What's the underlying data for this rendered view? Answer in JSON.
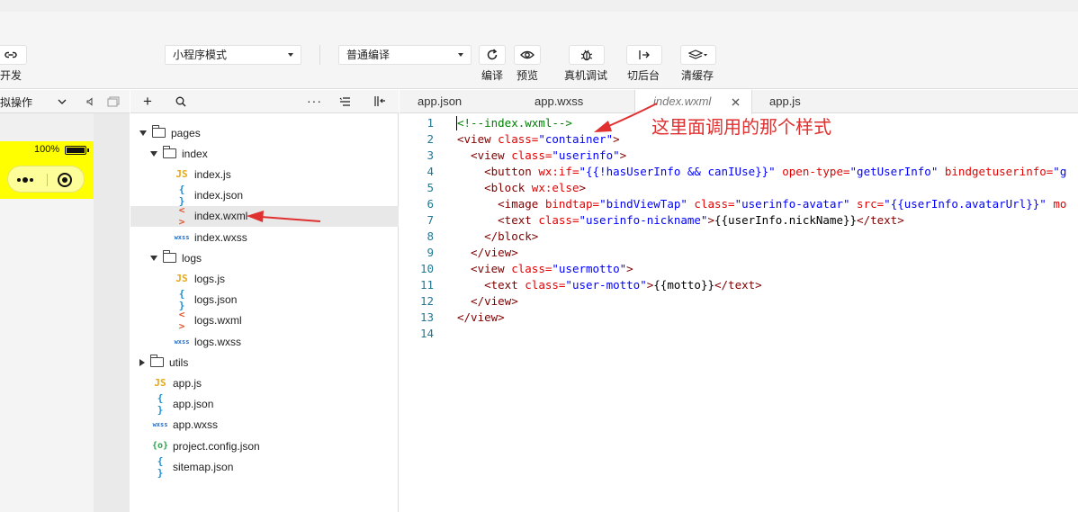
{
  "toolbar": {
    "cloud_label": "云开发",
    "mode_select": "小程序模式",
    "compile_select": "普通编译",
    "compile_label": "编译",
    "preview_label": "预览",
    "device_debug_label": "真机调试",
    "background_label": "切后台",
    "clear_cache_label": "清缓存"
  },
  "simulator": {
    "op_label": "模拟操作",
    "battery_text": "100%"
  },
  "file_tree": {
    "items": [
      {
        "label": "pages",
        "type": "folder",
        "expanded": true,
        "depth": 0
      },
      {
        "label": "index",
        "type": "folder",
        "expanded": true,
        "depth": 1
      },
      {
        "label": "index.js",
        "type": "js",
        "depth": 2
      },
      {
        "label": "index.json",
        "type": "json",
        "depth": 2
      },
      {
        "label": "index.wxml",
        "type": "wxml",
        "depth": 2,
        "selected": true
      },
      {
        "label": "index.wxss",
        "type": "wxss",
        "depth": 2
      },
      {
        "label": "logs",
        "type": "folder",
        "expanded": true,
        "depth": 1
      },
      {
        "label": "logs.js",
        "type": "js",
        "depth": 2
      },
      {
        "label": "logs.json",
        "type": "json",
        "depth": 2
      },
      {
        "label": "logs.wxml",
        "type": "wxml",
        "depth": 2
      },
      {
        "label": "logs.wxss",
        "type": "wxss",
        "depth": 2
      },
      {
        "label": "utils",
        "type": "folder",
        "expanded": false,
        "depth": 0
      },
      {
        "label": "app.js",
        "type": "js",
        "depth": 0
      },
      {
        "label": "app.json",
        "type": "json",
        "depth": 0
      },
      {
        "label": "app.wxss",
        "type": "wxss",
        "depth": 0
      },
      {
        "label": "project.config.json",
        "type": "cfg",
        "depth": 0
      },
      {
        "label": "sitemap.json",
        "type": "json",
        "depth": 0
      }
    ]
  },
  "file_icons": {
    "js": "JS",
    "json": "{ }",
    "wxml": "< >",
    "wxss": "wxss",
    "cfg": "{o}"
  },
  "editor": {
    "tabs": [
      {
        "label": "app.json",
        "active": false
      },
      {
        "label": "app.wxss",
        "active": false
      },
      {
        "label": "index.wxml",
        "active": true
      },
      {
        "label": "app.js",
        "active": false
      }
    ],
    "lines": [
      [
        {
          "t": "com",
          "s": "<!--index.wxml-->"
        }
      ],
      [
        {
          "t": "tag",
          "s": "<view "
        },
        {
          "t": "attr",
          "s": "class="
        },
        {
          "t": "val",
          "s": "\"container\""
        },
        {
          "t": "tag",
          "s": ">"
        }
      ],
      [
        {
          "t": "tag",
          "s": "  <view "
        },
        {
          "t": "attr",
          "s": "class="
        },
        {
          "t": "val",
          "s": "\"userinfo\""
        },
        {
          "t": "tag",
          "s": ">"
        }
      ],
      [
        {
          "t": "tag",
          "s": "    <button "
        },
        {
          "t": "attr",
          "s": "wx:if="
        },
        {
          "t": "val",
          "s": "\"{{!hasUserInfo && canIUse}}\""
        },
        {
          "t": "attr",
          "s": " open-type="
        },
        {
          "t": "val",
          "s": "\"getUserInfo\""
        },
        {
          "t": "attr",
          "s": " bindgetuserinfo="
        },
        {
          "t": "val",
          "s": "\"g"
        }
      ],
      [
        {
          "t": "tag",
          "s": "    <block "
        },
        {
          "t": "attr",
          "s": "wx:else"
        },
        {
          "t": "tag",
          "s": ">"
        }
      ],
      [
        {
          "t": "tag",
          "s": "      <image "
        },
        {
          "t": "attr",
          "s": "bindtap="
        },
        {
          "t": "val",
          "s": "\"bindViewTap\""
        },
        {
          "t": "attr",
          "s": " class="
        },
        {
          "t": "val",
          "s": "\"userinfo-avatar\""
        },
        {
          "t": "attr",
          "s": " src="
        },
        {
          "t": "val",
          "s": "\"{{userInfo.avatarUrl}}\""
        },
        {
          "t": "attr",
          "s": " mo"
        }
      ],
      [
        {
          "t": "tag",
          "s": "      <text "
        },
        {
          "t": "attr",
          "s": "class="
        },
        {
          "t": "val",
          "s": "\"userinfo-nickname\""
        },
        {
          "t": "tag",
          "s": ">"
        },
        {
          "t": "txt",
          "s": "{{userInfo.nickName}}"
        },
        {
          "t": "tag",
          "s": "</text>"
        }
      ],
      [
        {
          "t": "tag",
          "s": "    </block>"
        }
      ],
      [
        {
          "t": "tag",
          "s": "  </view>"
        }
      ],
      [
        {
          "t": "tag",
          "s": "  <view "
        },
        {
          "t": "attr",
          "s": "class="
        },
        {
          "t": "val",
          "s": "\"usermotto\""
        },
        {
          "t": "tag",
          "s": ">"
        }
      ],
      [
        {
          "t": "tag",
          "s": "    <text "
        },
        {
          "t": "attr",
          "s": "class="
        },
        {
          "t": "val",
          "s": "\"user-motto\""
        },
        {
          "t": "tag",
          "s": ">"
        },
        {
          "t": "txt",
          "s": "{{motto}}"
        },
        {
          "t": "tag",
          "s": "</text>"
        }
      ],
      [
        {
          "t": "tag",
          "s": "  </view>"
        }
      ],
      [
        {
          "t": "tag",
          "s": "</view>"
        }
      ],
      []
    ]
  },
  "annotation_text": "这里面调用的那个样式",
  "colors": {
    "tag": "#800000",
    "attr": "#e50000",
    "val": "#0000ff",
    "comment": "#008000",
    "annotation": "#e03030",
    "phone_bar": "#ffff00"
  }
}
